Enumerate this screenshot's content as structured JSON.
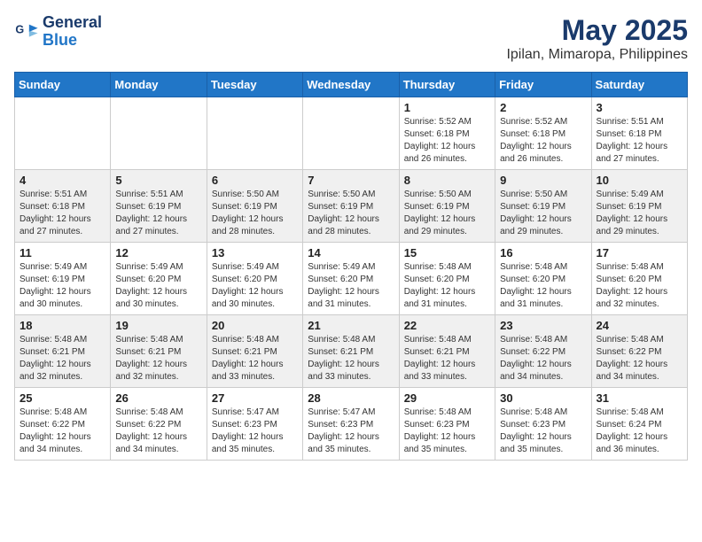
{
  "logo": {
    "line1": "General",
    "line2": "Blue"
  },
  "title": "May 2025",
  "subtitle": "Ipilan, Mimaropa, Philippines",
  "weekdays": [
    "Sunday",
    "Monday",
    "Tuesday",
    "Wednesday",
    "Thursday",
    "Friday",
    "Saturday"
  ],
  "weeks": [
    [
      {
        "day": "",
        "info": ""
      },
      {
        "day": "",
        "info": ""
      },
      {
        "day": "",
        "info": ""
      },
      {
        "day": "",
        "info": ""
      },
      {
        "day": "1",
        "info": "Sunrise: 5:52 AM\nSunset: 6:18 PM\nDaylight: 12 hours\nand 26 minutes."
      },
      {
        "day": "2",
        "info": "Sunrise: 5:52 AM\nSunset: 6:18 PM\nDaylight: 12 hours\nand 26 minutes."
      },
      {
        "day": "3",
        "info": "Sunrise: 5:51 AM\nSunset: 6:18 PM\nDaylight: 12 hours\nand 27 minutes."
      }
    ],
    [
      {
        "day": "4",
        "info": "Sunrise: 5:51 AM\nSunset: 6:18 PM\nDaylight: 12 hours\nand 27 minutes."
      },
      {
        "day": "5",
        "info": "Sunrise: 5:51 AM\nSunset: 6:19 PM\nDaylight: 12 hours\nand 27 minutes."
      },
      {
        "day": "6",
        "info": "Sunrise: 5:50 AM\nSunset: 6:19 PM\nDaylight: 12 hours\nand 28 minutes."
      },
      {
        "day": "7",
        "info": "Sunrise: 5:50 AM\nSunset: 6:19 PM\nDaylight: 12 hours\nand 28 minutes."
      },
      {
        "day": "8",
        "info": "Sunrise: 5:50 AM\nSunset: 6:19 PM\nDaylight: 12 hours\nand 29 minutes."
      },
      {
        "day": "9",
        "info": "Sunrise: 5:50 AM\nSunset: 6:19 PM\nDaylight: 12 hours\nand 29 minutes."
      },
      {
        "day": "10",
        "info": "Sunrise: 5:49 AM\nSunset: 6:19 PM\nDaylight: 12 hours\nand 29 minutes."
      }
    ],
    [
      {
        "day": "11",
        "info": "Sunrise: 5:49 AM\nSunset: 6:19 PM\nDaylight: 12 hours\nand 30 minutes."
      },
      {
        "day": "12",
        "info": "Sunrise: 5:49 AM\nSunset: 6:20 PM\nDaylight: 12 hours\nand 30 minutes."
      },
      {
        "day": "13",
        "info": "Sunrise: 5:49 AM\nSunset: 6:20 PM\nDaylight: 12 hours\nand 30 minutes."
      },
      {
        "day": "14",
        "info": "Sunrise: 5:49 AM\nSunset: 6:20 PM\nDaylight: 12 hours\nand 31 minutes."
      },
      {
        "day": "15",
        "info": "Sunrise: 5:48 AM\nSunset: 6:20 PM\nDaylight: 12 hours\nand 31 minutes."
      },
      {
        "day": "16",
        "info": "Sunrise: 5:48 AM\nSunset: 6:20 PM\nDaylight: 12 hours\nand 31 minutes."
      },
      {
        "day": "17",
        "info": "Sunrise: 5:48 AM\nSunset: 6:20 PM\nDaylight: 12 hours\nand 32 minutes."
      }
    ],
    [
      {
        "day": "18",
        "info": "Sunrise: 5:48 AM\nSunset: 6:21 PM\nDaylight: 12 hours\nand 32 minutes."
      },
      {
        "day": "19",
        "info": "Sunrise: 5:48 AM\nSunset: 6:21 PM\nDaylight: 12 hours\nand 32 minutes."
      },
      {
        "day": "20",
        "info": "Sunrise: 5:48 AM\nSunset: 6:21 PM\nDaylight: 12 hours\nand 33 minutes."
      },
      {
        "day": "21",
        "info": "Sunrise: 5:48 AM\nSunset: 6:21 PM\nDaylight: 12 hours\nand 33 minutes."
      },
      {
        "day": "22",
        "info": "Sunrise: 5:48 AM\nSunset: 6:21 PM\nDaylight: 12 hours\nand 33 minutes."
      },
      {
        "day": "23",
        "info": "Sunrise: 5:48 AM\nSunset: 6:22 PM\nDaylight: 12 hours\nand 34 minutes."
      },
      {
        "day": "24",
        "info": "Sunrise: 5:48 AM\nSunset: 6:22 PM\nDaylight: 12 hours\nand 34 minutes."
      }
    ],
    [
      {
        "day": "25",
        "info": "Sunrise: 5:48 AM\nSunset: 6:22 PM\nDaylight: 12 hours\nand 34 minutes."
      },
      {
        "day": "26",
        "info": "Sunrise: 5:48 AM\nSunset: 6:22 PM\nDaylight: 12 hours\nand 34 minutes."
      },
      {
        "day": "27",
        "info": "Sunrise: 5:47 AM\nSunset: 6:23 PM\nDaylight: 12 hours\nand 35 minutes."
      },
      {
        "day": "28",
        "info": "Sunrise: 5:47 AM\nSunset: 6:23 PM\nDaylight: 12 hours\nand 35 minutes."
      },
      {
        "day": "29",
        "info": "Sunrise: 5:48 AM\nSunset: 6:23 PM\nDaylight: 12 hours\nand 35 minutes."
      },
      {
        "day": "30",
        "info": "Sunrise: 5:48 AM\nSunset: 6:23 PM\nDaylight: 12 hours\nand 35 minutes."
      },
      {
        "day": "31",
        "info": "Sunrise: 5:48 AM\nSunset: 6:24 PM\nDaylight: 12 hours\nand 36 minutes."
      }
    ]
  ]
}
